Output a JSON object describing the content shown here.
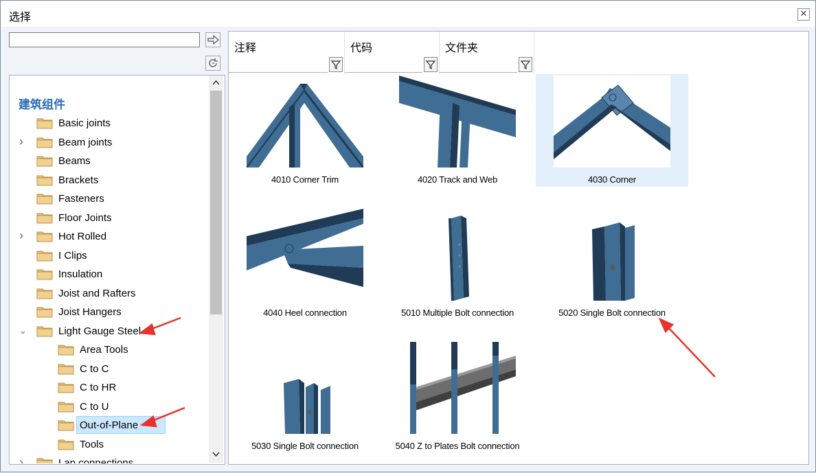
{
  "window": {
    "title": "选择"
  },
  "search": {
    "value": "",
    "placeholder": ""
  },
  "tree": {
    "root_label": "建筑组件",
    "items": [
      {
        "label": "Basic joints"
      },
      {
        "label": "Beam joints"
      },
      {
        "label": "Beams"
      },
      {
        "label": "Brackets"
      },
      {
        "label": "Fasteners"
      },
      {
        "label": "Floor Joints"
      },
      {
        "label": "Hot Rolled"
      },
      {
        "label": "I Clips"
      },
      {
        "label": "Insulation"
      },
      {
        "label": "Joist and Rafters"
      },
      {
        "label": "Joist Hangers"
      },
      {
        "label": "Light Gauge Steel"
      },
      {
        "label": "Area Tools"
      },
      {
        "label": "C to C"
      },
      {
        "label": "C to HR"
      },
      {
        "label": "C to U"
      },
      {
        "label": "Out-of-Plane"
      },
      {
        "label": "Tools"
      },
      {
        "label": "Lap connections"
      }
    ],
    "selected": "Out-of-Plane"
  },
  "columns": [
    {
      "label": "注释"
    },
    {
      "label": "代码"
    },
    {
      "label": "文件夹"
    }
  ],
  "thumbnails": [
    {
      "caption": "4010 Corner Trim"
    },
    {
      "caption": "4020 Track and Web"
    },
    {
      "caption": "4030 Corner"
    },
    {
      "caption": "4040 Heel connection"
    },
    {
      "caption": "5010 Multiple Bolt connection"
    },
    {
      "caption": "5020 Single Bolt connection"
    },
    {
      "caption": "5030 Single Bolt connection"
    },
    {
      "caption": "5040 Z to Plates Bolt connection"
    }
  ],
  "colors": {
    "steel": "#3f6d94",
    "steel_dark": "#1f3b55",
    "accent": "#2e6db4",
    "annotation": "#e8322c"
  }
}
